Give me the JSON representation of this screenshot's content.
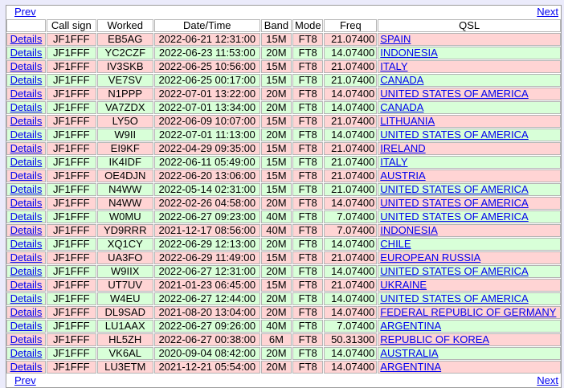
{
  "nav": {
    "prev_label": "Prev",
    "next_label": "Next"
  },
  "columns": [
    "",
    "Call sign",
    "Worked",
    "Date/Time",
    "Band",
    "Mode",
    "Freq",
    "QSL"
  ],
  "rows": [
    {
      "details": "Details",
      "call": "JF1FFF",
      "worked": "EB5AG",
      "datetime": "2022-06-21 12:31:00",
      "band": "15M",
      "mode": "FT8",
      "freq": "21.07400",
      "qsl": "SPAIN"
    },
    {
      "details": "Details",
      "call": "JF1FFF",
      "worked": "YC2CZF",
      "datetime": "2022-06-23 11:53:00",
      "band": "20M",
      "mode": "FT8",
      "freq": "14.07400",
      "qsl": "INDONESIA"
    },
    {
      "details": "Details",
      "call": "JF1FFF",
      "worked": "IV3SKB",
      "datetime": "2022-06-25 10:56:00",
      "band": "15M",
      "mode": "FT8",
      "freq": "21.07400",
      "qsl": "ITALY"
    },
    {
      "details": "Details",
      "call": "JF1FFF",
      "worked": "VE7SV",
      "datetime": "2022-06-25 00:17:00",
      "band": "15M",
      "mode": "FT8",
      "freq": "21.07400",
      "qsl": "CANADA"
    },
    {
      "details": "Details",
      "call": "JF1FFF",
      "worked": "N1PPP",
      "datetime": "2022-07-01 13:22:00",
      "band": "20M",
      "mode": "FT8",
      "freq": "14.07400",
      "qsl": "UNITED STATES OF AMERICA"
    },
    {
      "details": "Details",
      "call": "JF1FFF",
      "worked": "VA7ZDX",
      "datetime": "2022-07-01 13:34:00",
      "band": "20M",
      "mode": "FT8",
      "freq": "14.07400",
      "qsl": "CANADA"
    },
    {
      "details": "Details",
      "call": "JF1FFF",
      "worked": "LY5O",
      "datetime": "2022-06-09 10:07:00",
      "band": "15M",
      "mode": "FT8",
      "freq": "21.07400",
      "qsl": "LITHUANIA"
    },
    {
      "details": "Details",
      "call": "JF1FFF",
      "worked": "W9II",
      "datetime": "2022-07-01 11:13:00",
      "band": "20M",
      "mode": "FT8",
      "freq": "14.07400",
      "qsl": "UNITED STATES OF AMERICA"
    },
    {
      "details": "Details",
      "call": "JF1FFF",
      "worked": "EI9KF",
      "datetime": "2022-04-29 09:35:00",
      "band": "15M",
      "mode": "FT8",
      "freq": "21.07400",
      "qsl": "IRELAND"
    },
    {
      "details": "Details",
      "call": "JF1FFF",
      "worked": "IK4IDF",
      "datetime": "2022-06-11 05:49:00",
      "band": "15M",
      "mode": "FT8",
      "freq": "21.07400",
      "qsl": "ITALY"
    },
    {
      "details": "Details",
      "call": "JF1FFF",
      "worked": "OE4DJN",
      "datetime": "2022-06-20 13:06:00",
      "band": "15M",
      "mode": "FT8",
      "freq": "21.07400",
      "qsl": "AUSTRIA"
    },
    {
      "details": "Details",
      "call": "JF1FFF",
      "worked": "N4WW",
      "datetime": "2022-05-14 02:31:00",
      "band": "15M",
      "mode": "FT8",
      "freq": "21.07400",
      "qsl": "UNITED STATES OF AMERICA"
    },
    {
      "details": "Details",
      "call": "JF1FFF",
      "worked": "N4WW",
      "datetime": "2022-02-26 04:58:00",
      "band": "20M",
      "mode": "FT8",
      "freq": "14.07400",
      "qsl": "UNITED STATES OF AMERICA"
    },
    {
      "details": "Details",
      "call": "JF1FFF",
      "worked": "W0MU",
      "datetime": "2022-06-27 09:23:00",
      "band": "40M",
      "mode": "FT8",
      "freq": "7.07400",
      "qsl": "UNITED STATES OF AMERICA"
    },
    {
      "details": "Details",
      "call": "JF1FFF",
      "worked": "YD9RRR",
      "datetime": "2021-12-17 08:56:00",
      "band": "40M",
      "mode": "FT8",
      "freq": "7.07400",
      "qsl": "INDONESIA"
    },
    {
      "details": "Details",
      "call": "JF1FFF",
      "worked": "XQ1CY",
      "datetime": "2022-06-29 12:13:00",
      "band": "20M",
      "mode": "FT8",
      "freq": "14.07400",
      "qsl": "CHILE"
    },
    {
      "details": "Details",
      "call": "JF1FFF",
      "worked": "UA3FO",
      "datetime": "2022-06-29 11:49:00",
      "band": "15M",
      "mode": "FT8",
      "freq": "21.07400",
      "qsl": "EUROPEAN RUSSIA"
    },
    {
      "details": "Details",
      "call": "JF1FFF",
      "worked": "W9IIX",
      "datetime": "2022-06-27 12:31:00",
      "band": "20M",
      "mode": "FT8",
      "freq": "14.07400",
      "qsl": "UNITED STATES OF AMERICA"
    },
    {
      "details": "Details",
      "call": "JF1FFF",
      "worked": "UT7UV",
      "datetime": "2021-01-23 06:45:00",
      "band": "15M",
      "mode": "FT8",
      "freq": "21.07400",
      "qsl": "UKRAINE"
    },
    {
      "details": "Details",
      "call": "JF1FFF",
      "worked": "W4EU",
      "datetime": "2022-06-27 12:44:00",
      "band": "20M",
      "mode": "FT8",
      "freq": "14.07400",
      "qsl": "UNITED STATES OF AMERICA"
    },
    {
      "details": "Details",
      "call": "JF1FFF",
      "worked": "DL9SAD",
      "datetime": "2021-08-20 13:04:00",
      "band": "20M",
      "mode": "FT8",
      "freq": "14.07400",
      "qsl": "FEDERAL REPUBLIC OF GERMANY"
    },
    {
      "details": "Details",
      "call": "JF1FFF",
      "worked": "LU1AAX",
      "datetime": "2022-06-27 09:26:00",
      "band": "40M",
      "mode": "FT8",
      "freq": "7.07400",
      "qsl": "ARGENTINA"
    },
    {
      "details": "Details",
      "call": "JF1FFF",
      "worked": "HL5ZH",
      "datetime": "2022-06-27 00:38:00",
      "band": "6M",
      "mode": "FT8",
      "freq": "50.31300",
      "qsl": "REPUBLIC OF KOREA"
    },
    {
      "details": "Details",
      "call": "JF1FFF",
      "worked": "VK6AL",
      "datetime": "2020-09-04 08:42:00",
      "band": "20M",
      "mode": "FT8",
      "freq": "14.07400",
      "qsl": "AUSTRALIA"
    },
    {
      "details": "Details",
      "call": "JF1FFF",
      "worked": "LU3ETM",
      "datetime": "2021-12-21 05:54:00",
      "band": "20M",
      "mode": "FT8",
      "freq": "14.07400",
      "qsl": "ARGENTINA"
    }
  ],
  "colors": {
    "odd_row": "#ffd4d4",
    "even_row": "#d8ffd8",
    "link": "#0000ee",
    "page_bg": "#ebebfb"
  }
}
